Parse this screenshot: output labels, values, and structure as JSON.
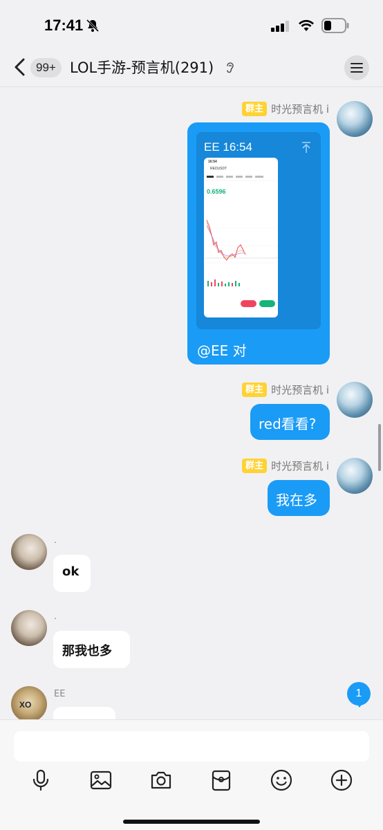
{
  "status_bar": {
    "time": "17:41"
  },
  "header": {
    "unread_count": "99+",
    "title": "LOL手游-预言机(291)"
  },
  "messages": {
    "m1": {
      "badge": "群主",
      "sender": "时光预言机 i",
      "card_header": "EE 16:54",
      "card_caption": "@EE 对",
      "screenshot": {
        "time": "16:54",
        "pair": "REDUSDT",
        "price": "0.6596"
      }
    },
    "m2": {
      "badge": "群主",
      "sender": "时光预言机 i",
      "text": "red看看?"
    },
    "m3": {
      "badge": "群主",
      "sender": "时光预言机 i",
      "text": "我在多"
    },
    "m4": {
      "sender": ".",
      "text": "ok"
    },
    "m5": {
      "sender": ".",
      "text": "那我也多"
    },
    "m6": {
      "sender": "EE",
      "avatar_text": "XO"
    }
  },
  "unread_float": "1",
  "composer": {
    "placeholder": ""
  },
  "toolbar_icons": [
    "mic-icon",
    "image-icon",
    "camera-icon",
    "red-packet-icon",
    "emoji-icon",
    "plus-icon"
  ]
}
